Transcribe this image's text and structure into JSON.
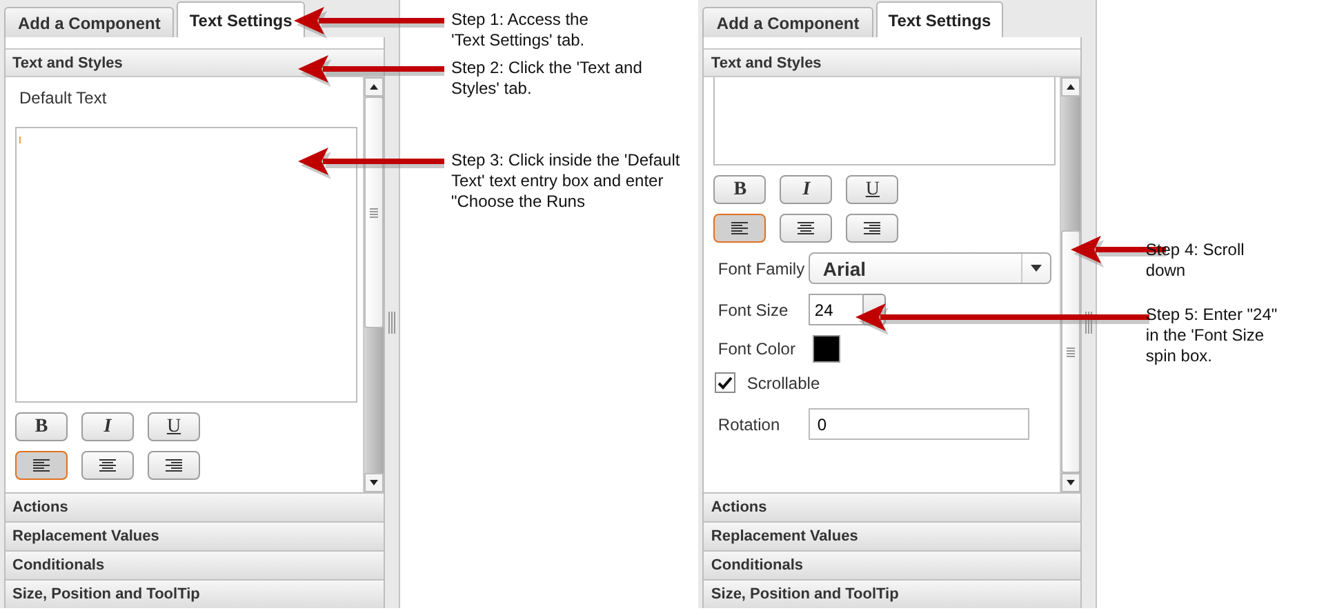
{
  "panels": [
    {
      "tabs": [
        {
          "label": "Add a Component",
          "selected": false
        },
        {
          "label": "Text Settings",
          "selected": true
        }
      ],
      "section": "Text and Styles",
      "scrolled": false,
      "controls": [
        {
          "kind": "label",
          "label": "Default Text"
        },
        {
          "kind": "textarea",
          "focused": true
        },
        {
          "kind": "format",
          "buttons": [
            {
              "label": "B"
            },
            {
              "label": "I"
            },
            {
              "label": "U"
            }
          ]
        },
        {
          "kind": "align",
          "buttons": [
            {
              "selected": true
            },
            {
              "selected": false
            },
            {
              "selected": false
            }
          ]
        }
      ],
      "accordion": [
        "Actions",
        "Replacement Values",
        "Conditionals",
        "Size, Position and ToolTip"
      ],
      "notes": [
        "Step 1: Access the 'Text Settings' tab.",
        "Step 2: Click the 'Text and Styles' tab.",
        "Step 3: Click inside the 'Default Text' text entry box and enter \"Choose the Runs"
      ]
    },
    {
      "tabs": [
        {
          "label": "Add a Component",
          "selected": false
        },
        {
          "label": "Text Settings",
          "selected": true
        }
      ],
      "section": "Text and Styles",
      "scrolled": true,
      "controls": [
        {
          "kind": "textarea"
        },
        {
          "kind": "format",
          "buttons": [
            {
              "label": "B"
            },
            {
              "label": "I"
            },
            {
              "label": "U"
            }
          ]
        },
        {
          "kind": "align",
          "buttons": [
            {
              "selected": true
            },
            {
              "selected": false
            },
            {
              "selected": false
            }
          ]
        },
        {
          "kind": "select",
          "label": "Font Family",
          "value": "Arial"
        },
        {
          "kind": "spin",
          "label": "Font Size",
          "value": "24"
        },
        {
          "kind": "color",
          "label": "Font Color",
          "color": "#000000"
        },
        {
          "kind": "checkbox",
          "label": "Scrollable",
          "checked": true
        },
        {
          "kind": "input",
          "label": "Rotation",
          "value": "0"
        }
      ],
      "accordion": [
        "Actions",
        "Replacement Values",
        "Conditionals",
        "Size, Position and ToolTip"
      ],
      "notes": [
        "Step 4: Scroll down",
        "Step 5: Enter \"24\" in the 'Font Size spin box."
      ]
    }
  ]
}
